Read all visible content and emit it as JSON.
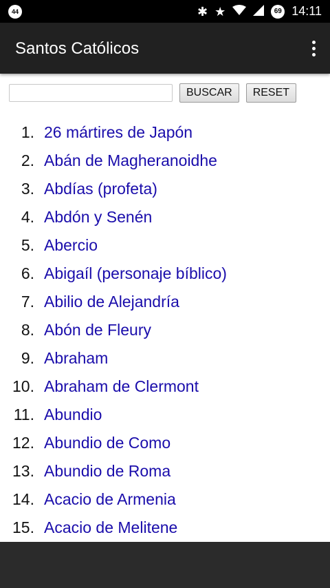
{
  "status_bar": {
    "notification_icon": "circle-notification-icon",
    "notification_text": "44",
    "icons": [
      "bluetooth-icon",
      "star-icon",
      "wifi-icon",
      "signal-icon",
      "battery-icon"
    ],
    "battery_level": "69",
    "time": "14:11"
  },
  "app_bar": {
    "title": "Santos Católicos",
    "menu_icon": "overflow-menu-icon"
  },
  "search": {
    "value": "",
    "placeholder": "",
    "buscar_label": "BUSCAR",
    "reset_label": "RESET"
  },
  "saints": [
    {
      "num": "1.",
      "name": "26 mártires de Japón"
    },
    {
      "num": "2.",
      "name": "Abán de Magheranoidhe"
    },
    {
      "num": "3.",
      "name": "Abdías (profeta)"
    },
    {
      "num": "4.",
      "name": "Abdón y Senén"
    },
    {
      "num": "5.",
      "name": "Abercio"
    },
    {
      "num": "6.",
      "name": "Abigaíl (personaje bíblico)"
    },
    {
      "num": "7.",
      "name": "Abilio de Alejandría"
    },
    {
      "num": "8.",
      "name": "Abón de Fleury"
    },
    {
      "num": "9.",
      "name": "Abraham"
    },
    {
      "num": "10.",
      "name": "Abraham de Clermont"
    },
    {
      "num": "11.",
      "name": "Abundio"
    },
    {
      "num": "12.",
      "name": "Abundio de Como"
    },
    {
      "num": "13.",
      "name": "Abundio de Roma"
    },
    {
      "num": "14.",
      "name": "Acacio de Armenia"
    },
    {
      "num": "15.",
      "name": "Acacio de Melitene"
    }
  ],
  "colors": {
    "app_bar": "#212121",
    "status_bar": "#000000",
    "link": "#1a0dab",
    "bottom_bar": "#2b2b2b"
  }
}
